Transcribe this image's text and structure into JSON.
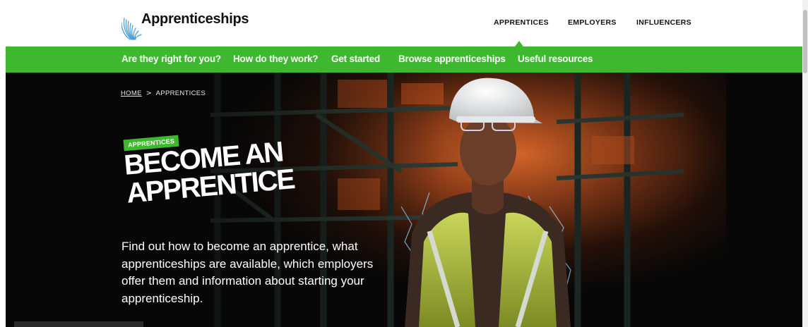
{
  "brand": {
    "name": "Apprenticeships",
    "logo_icon": "fan-swoosh-icon"
  },
  "audience_nav": {
    "items": [
      {
        "label": "APPRENTICES",
        "active": true
      },
      {
        "label": "EMPLOYERS",
        "active": false
      },
      {
        "label": "INFLUENCERS",
        "active": false
      }
    ]
  },
  "section_nav": {
    "items": [
      {
        "label": "Are they right for you?"
      },
      {
        "label": "How do they work?"
      },
      {
        "label": "Get started"
      },
      {
        "label": "Browse apprenticeships"
      },
      {
        "label": "Useful resources"
      }
    ]
  },
  "breadcrumb": {
    "home": "HOME",
    "separator": ">",
    "current": "APPRENTICES"
  },
  "hero": {
    "tag": "APPRENTICES",
    "title_line1": "BECOME AN",
    "title_line2": "APPRENTICE",
    "description": "Find out how to become an apprentice, what apprenticeships are available, which employers offer them and information about starting your apprenticeship.",
    "image_icon": "apprentice-photo"
  },
  "colors": {
    "accent": "#3eb82f",
    "hero_bg": "#070707",
    "text_dark": "#111111"
  }
}
